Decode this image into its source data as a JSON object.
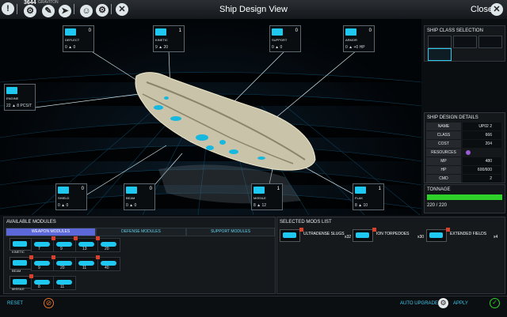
{
  "header": {
    "resource_count": "3644",
    "resource_name": "GRAVITON",
    "title": "Ship Design View",
    "close_label": "Close"
  },
  "toolbar_icons": [
    "warning-icon",
    "tech-icon",
    "diplomacy-icon",
    "ship-icon",
    "leaders-icon",
    "tools-icon"
  ],
  "viewport": {
    "cards": [
      {
        "id": "deflect",
        "label": "DEFLECT",
        "count": "0",
        "stat_a": "0",
        "stat_b": "0"
      },
      {
        "id": "kinetic",
        "label": "KINETIC",
        "count": "1",
        "stat_a": "9",
        "stat_b": "20"
      },
      {
        "id": "support",
        "label": "SUPPORT",
        "count": "0",
        "stat_a": "0",
        "stat_b": "0"
      },
      {
        "id": "armor",
        "label": "ARMOR",
        "count": "0",
        "stat_a": "0",
        "stat_b": "+0 HP"
      },
      {
        "id": "engine",
        "label": "ENGINE",
        "count": "",
        "stat_a": "22",
        "stat_b": "8 PCS/T"
      },
      {
        "id": "shield",
        "label": "SHIELD",
        "count": "0",
        "stat_a": "0",
        "stat_b": "0"
      },
      {
        "id": "beam",
        "label": "BEAM",
        "count": "0",
        "stat_a": "0",
        "stat_b": "0"
      },
      {
        "id": "missile",
        "label": "MISSILE",
        "count": "1",
        "stat_a": "8",
        "stat_b": "12"
      },
      {
        "id": "flak",
        "label": "FLAK",
        "count": "1",
        "stat_a": "8",
        "stat_b": "10"
      }
    ]
  },
  "class_selection": {
    "title": "SHIP CLASS SELECTION"
  },
  "design_details": {
    "title": "SHIP DESIGN DETAILS",
    "name_label": "NAME",
    "name_value": "UP02 2",
    "class_label": "CLASS",
    "class_value": "666",
    "cost_label": "COST",
    "cost_value": "204",
    "resources_label": "RESOURCES",
    "mp_label": "MP",
    "mp_value": "480",
    "hp_label": "HP",
    "hp_value": "600/600",
    "cmd_label": "CMD",
    "cmd_value": "2"
  },
  "tonnage": {
    "title": "TONNAGE",
    "value": "220 / 220",
    "fill": 1.0,
    "bar_color": "#2ed12a"
  },
  "available": {
    "title": "AVAILABLE MODULES",
    "tabs": [
      "WEAPON MODULES",
      "DEFENSE MODULES",
      "SUPPORT MODULES"
    ],
    "rows": [
      {
        "label": "KINETIC",
        "values": [
          "7",
          "9",
          "13",
          "20"
        ]
      },
      {
        "label": "BEAM",
        "values": [
          "9",
          "20",
          "11",
          "40"
        ]
      },
      {
        "label": "MISSILE",
        "values": [
          "8",
          "11"
        ]
      }
    ]
  },
  "selected": {
    "title": "SELECTED MODS LIST",
    "items": [
      {
        "name": "ULTRADENSE SLUGS",
        "mult": "x32"
      },
      {
        "name": "ION TORPEDOES",
        "mult": "x30"
      },
      {
        "name": "EXTENDED FIELDS",
        "mult": "x4"
      }
    ]
  },
  "actions": {
    "reset": "RESET",
    "auto_upgrade": "AUTO UPGRADE",
    "apply": "APPLY"
  },
  "colors": {
    "accent": "#2ec8f0",
    "tab_active": "#5c67d8",
    "tonnage": "#2ed12a"
  }
}
